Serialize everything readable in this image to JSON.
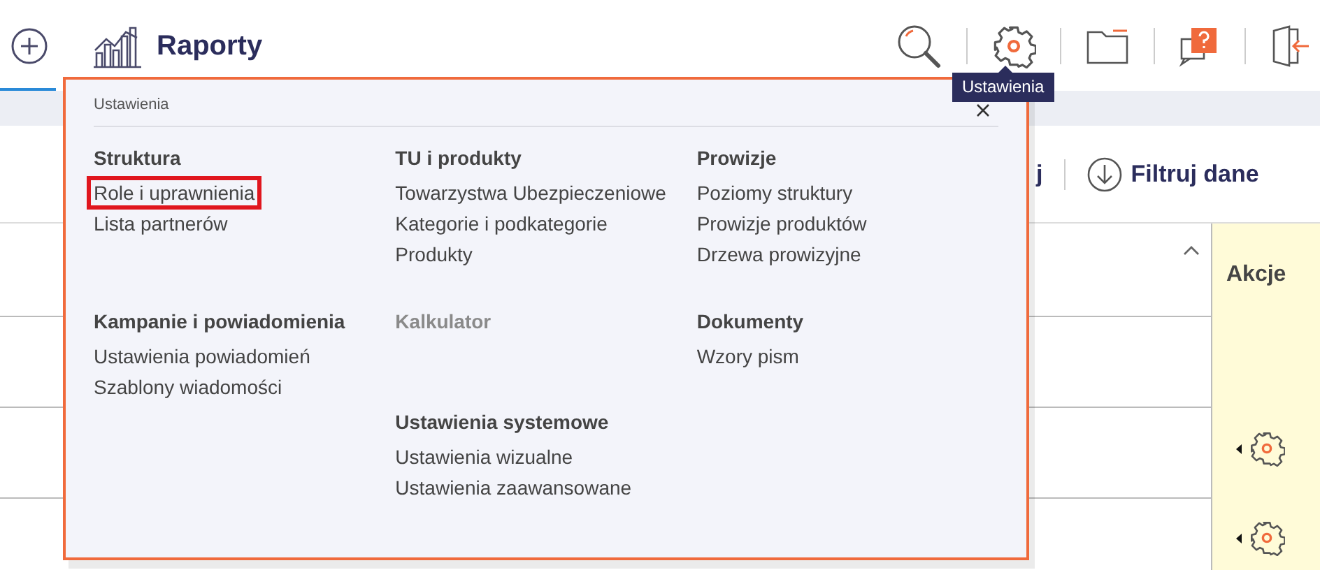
{
  "header": {
    "title": "Raporty",
    "tooltip": "Ustawienia"
  },
  "toolbar": {
    "partial_button": "j",
    "filter_button": "Filtruj dane"
  },
  "table": {
    "actions_header": "Akcje",
    "rows": [
      {
        "kind": "empty"
      },
      {
        "kind": "actions"
      },
      {
        "kind": "actions"
      }
    ]
  },
  "settings_menu": {
    "title": "Ustawienia",
    "columns": [
      [
        {
          "heading": "Struktura",
          "disabled": false,
          "items": [
            {
              "label": "Role i uprawnienia",
              "selected": true
            },
            {
              "label": "Lista partnerów",
              "selected": false
            }
          ]
        },
        {
          "heading": "Kampanie i powiadomienia",
          "disabled": false,
          "items": [
            {
              "label": "Ustawienia powiadomień",
              "selected": false
            },
            {
              "label": "Szablony wiadomości",
              "selected": false
            }
          ]
        }
      ],
      [
        {
          "heading": "TU i produkty",
          "disabled": false,
          "items": [
            {
              "label": "Towarzystwa Ubezpieczeniowe",
              "selected": false
            },
            {
              "label": "Kategorie i podkategorie",
              "selected": false
            },
            {
              "label": "Produkty",
              "selected": false
            }
          ]
        },
        {
          "heading": "Kalkulator",
          "disabled": true
        },
        {
          "heading": "Ustawienia systemowe",
          "disabled": false,
          "items": [
            {
              "label": "Ustawienia wizualne",
              "selected": false
            },
            {
              "label": "Ustawienia zaawansowane",
              "selected": false
            }
          ]
        }
      ],
      [
        {
          "heading": "Prowizje",
          "disabled": false,
          "items": [
            {
              "label": "Poziomy struktury",
              "selected": false
            },
            {
              "label": "Prowizje produktów",
              "selected": false
            },
            {
              "label": "Drzewa prowizyjne",
              "selected": false
            }
          ]
        },
        {
          "heading": "Dokumenty",
          "disabled": false,
          "items": [
            {
              "label": "Wzory pism",
              "selected": false
            }
          ]
        }
      ]
    ]
  }
}
